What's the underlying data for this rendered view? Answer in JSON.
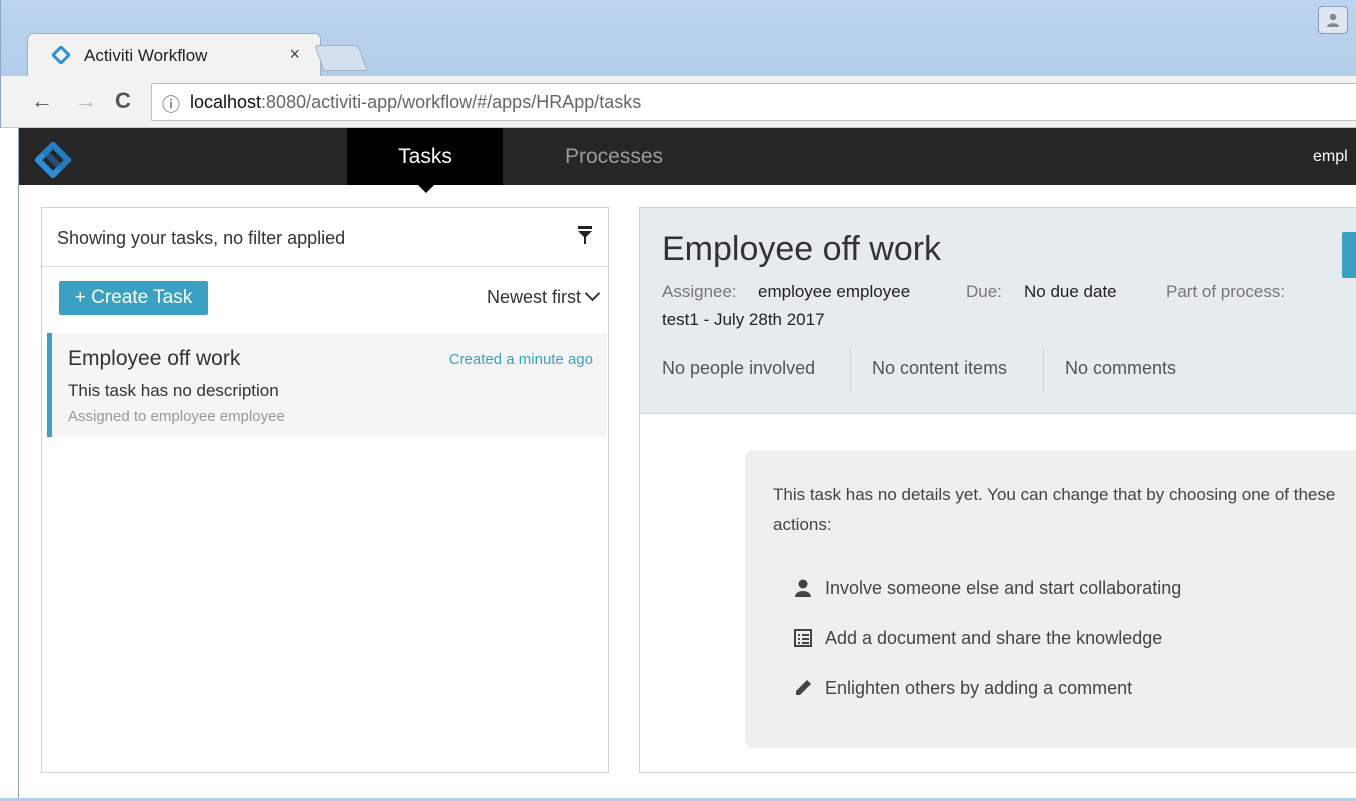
{
  "browser": {
    "tab_title": "Activiti Workflow",
    "tab_close": "×",
    "url_host": "localhost",
    "url_path": ":8080/activiti-app/workflow/#/apps/HRApp/tasks",
    "info_glyph": "ⓘ",
    "back_glyph": "←",
    "forward_glyph": "→",
    "reload_glyph": "C"
  },
  "navbar": {
    "tabs": [
      {
        "label": "Tasks",
        "active": true
      },
      {
        "label": "Processes",
        "active": false
      }
    ],
    "user_label": "empl"
  },
  "task_list": {
    "filter_text": "Showing your tasks, no filter applied",
    "create_button": "+ Create Task",
    "sort_label": "Newest first",
    "items": [
      {
        "title": "Employee off work",
        "created": "Created a minute ago",
        "description": "This task has no description",
        "assigned": "Assigned to employee employee"
      }
    ]
  },
  "task_detail": {
    "title": "Employee off work",
    "assignee_label": "Assignee:",
    "assignee_value": "employee employee",
    "due_label": "Due:",
    "due_value": "No due date",
    "process_label": "Part of process:",
    "process_value": "test1 - July 28th 2017",
    "counts": {
      "people": "No people involved",
      "content": "No content items",
      "comments": "No comments"
    },
    "empty_message": "This task has no details yet. You can change that by choosing one of these actions:",
    "actions": [
      {
        "icon": "user-icon",
        "label": "Involve someone else and start collaborating"
      },
      {
        "icon": "document-icon",
        "label": "Add a document and share the knowledge"
      },
      {
        "icon": "pencil-icon",
        "label": "Enlighten others by adding a comment"
      }
    ]
  },
  "colors": {
    "accent": "#3ba1c2",
    "navbar": "#262626",
    "detail_header": "#e6ebef"
  }
}
